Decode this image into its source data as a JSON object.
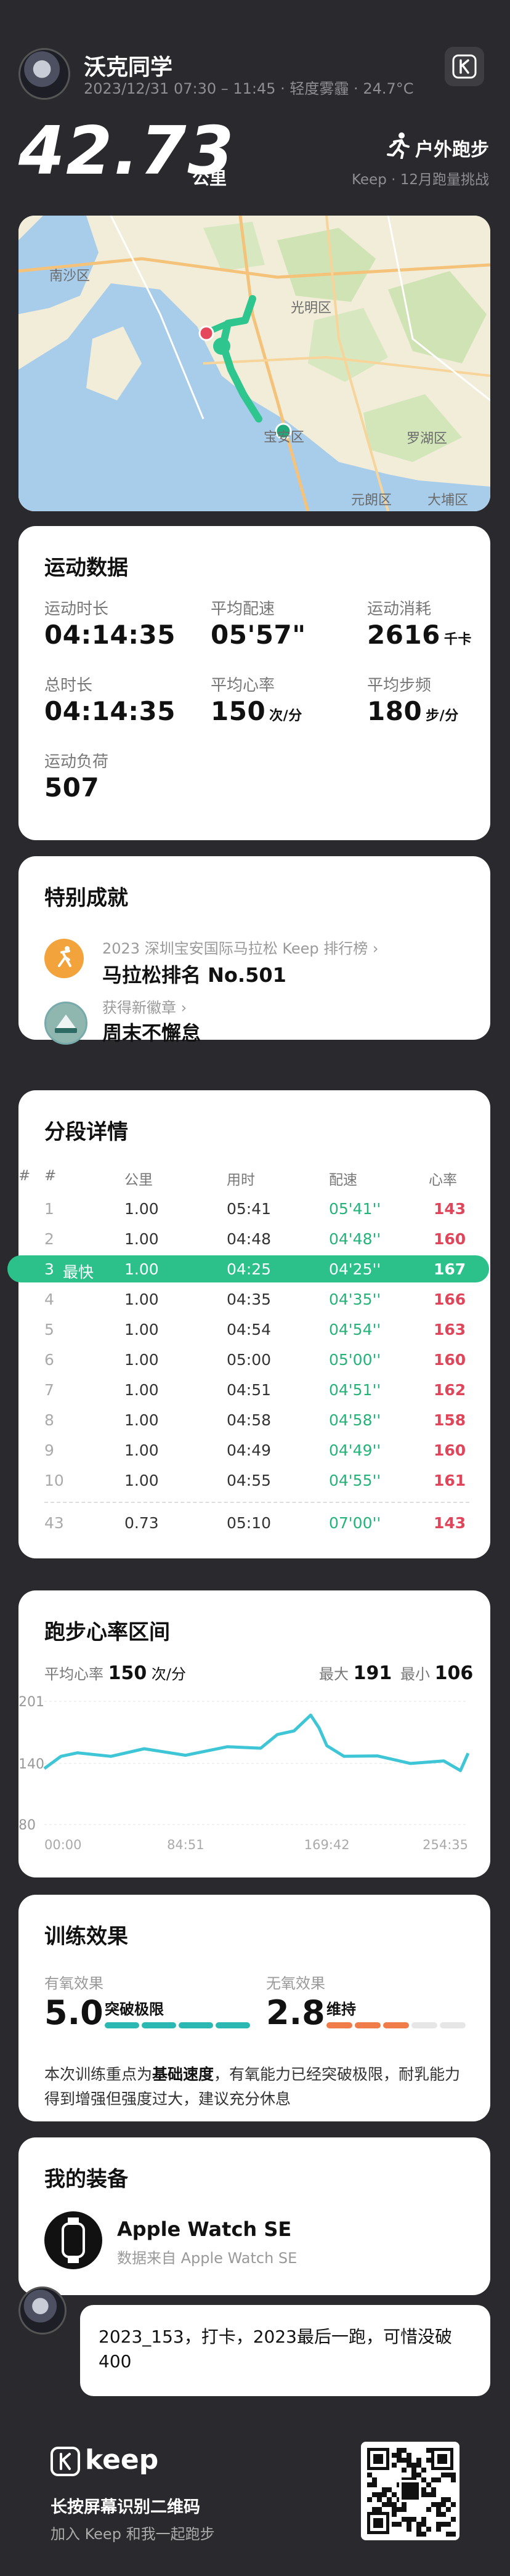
{
  "user": {
    "name": "沃克同学",
    "meta": "2023/12/31 07:30 – 11:45 · 轻度雾霾 · 24.7°C"
  },
  "summary": {
    "distance": "42.73",
    "unit": "公里",
    "sport": "户外跑步",
    "challenge": "Keep · 12月跑量挑战"
  },
  "map": {
    "labels": [
      "南沙区",
      "光明区",
      "宝安区",
      "罗湖区",
      "元朗区",
      "大埔区"
    ]
  },
  "stats": {
    "title": "运动数据",
    "items": [
      {
        "label": "运动时长",
        "value": "04:14:35",
        "unit": ""
      },
      {
        "label": "平均配速",
        "value": "05'57\"",
        "unit": ""
      },
      {
        "label": "运动消耗",
        "value": "2616",
        "unit": "千卡"
      },
      {
        "label": "总时长",
        "value": "04:14:35",
        "unit": ""
      },
      {
        "label": "平均心率",
        "value": "150",
        "unit": "次/分"
      },
      {
        "label": "平均步频",
        "value": "180",
        "unit": "步/分"
      },
      {
        "label": "运动负荷",
        "value": "507",
        "unit": ""
      }
    ]
  },
  "achievements": {
    "title": "特别成就",
    "items": [
      {
        "sub": "2023 深圳宝安国际马拉松 Keep 排行榜",
        "main": "马拉松排名 No.501"
      },
      {
        "sub": "获得新徽章",
        "main": "周末不懈怠"
      }
    ]
  },
  "splits": {
    "title": "分段详情",
    "headers": [
      "#",
      "公里",
      "用时",
      "配速",
      "心率"
    ],
    "best_label": "最快",
    "rows": [
      {
        "n": "1",
        "km": "1.00",
        "time": "05:41",
        "pace": "05'41''",
        "hr": "143"
      },
      {
        "n": "2",
        "km": "1.00",
        "time": "04:48",
        "pace": "04'48''",
        "hr": "160"
      },
      {
        "n": "3",
        "km": "1.00",
        "time": "04:25",
        "pace": "04'25''",
        "hr": "167"
      },
      {
        "n": "4",
        "km": "1.00",
        "time": "04:35",
        "pace": "04'35''",
        "hr": "166"
      },
      {
        "n": "5",
        "km": "1.00",
        "time": "04:54",
        "pace": "04'54''",
        "hr": "163"
      },
      {
        "n": "6",
        "km": "1.00",
        "time": "05:00",
        "pace": "05'00''",
        "hr": "160"
      },
      {
        "n": "7",
        "km": "1.00",
        "time": "04:51",
        "pace": "04'51''",
        "hr": "162"
      },
      {
        "n": "8",
        "km": "1.00",
        "time": "04:58",
        "pace": "04'58''",
        "hr": "158"
      },
      {
        "n": "9",
        "km": "1.00",
        "time": "04:49",
        "pace": "04'49''",
        "hr": "160"
      },
      {
        "n": "10",
        "km": "1.00",
        "time": "04:55",
        "pace": "04'55''",
        "hr": "161"
      }
    ],
    "last": {
      "n": "43",
      "km": "0.73",
      "time": "05:10",
      "pace": "07'00''",
      "hr": "143"
    }
  },
  "heart_rate": {
    "title": "跑步心率区间",
    "avg_label": "平均心率",
    "avg": "150",
    "avg_unit": "次/分",
    "max_label": "最大",
    "max": "191",
    "min_label": "最小",
    "min": "106",
    "y_ticks": [
      "201",
      "140",
      "80"
    ],
    "x_ticks": [
      "00:00",
      "84:51",
      "169:42",
      "254:35"
    ]
  },
  "chart_data": {
    "type": "line",
    "title": "",
    "xlabel": "",
    "ylabel": "",
    "x": [
      0,
      10,
      20,
      40,
      60,
      84.85,
      110,
      130,
      140,
      150,
      160,
      165,
      169.7,
      180,
      200,
      220,
      240,
      250,
      254.58
    ],
    "series": [
      {
        "values": [
          135,
          150,
          148,
          150,
          152,
          151,
          154,
          158,
          166,
          175,
          185,
          178,
          155,
          150,
          145,
          143,
          140,
          136,
          150
        ]
      }
    ],
    "ylim": [
      80,
      201
    ],
    "xlim": [
      0,
      254.58
    ],
    "x_ticks": [
      "00:00",
      "84:51",
      "169:42",
      "254:35"
    ],
    "y_ticks": [
      201,
      140,
      80
    ]
  },
  "training": {
    "title": "训练效果",
    "aerobic_label": "有氧效果",
    "aerobic_value": "5.0",
    "aerobic_tag": "突破极限",
    "anaerobic_label": "无氧效果",
    "anaerobic_value": "2.8",
    "anaerobic_tag": "维持",
    "desc_pre": "本次训练重点为",
    "desc_bold": "基础速度",
    "desc_post": "，有氧能力已经突破极限，耐乳能力得到增强但强度过大，建议充分休息"
  },
  "gear": {
    "title": "我的装备",
    "name": "Apple Watch SE",
    "source": "数据来自 Apple Watch SE"
  },
  "comment": {
    "text": "2023_153，打卡，2023最后一跑，可惜没破400"
  },
  "footer": {
    "brand": "keep",
    "line1": "长按屏幕识别二维码",
    "line2": "加入 Keep 和我一起跑步"
  },
  "colors": {
    "accent": "#2cc18a",
    "pace_green": "#25b37a",
    "hr_red": "#e0455a",
    "line_teal": "#3ec6d6"
  }
}
